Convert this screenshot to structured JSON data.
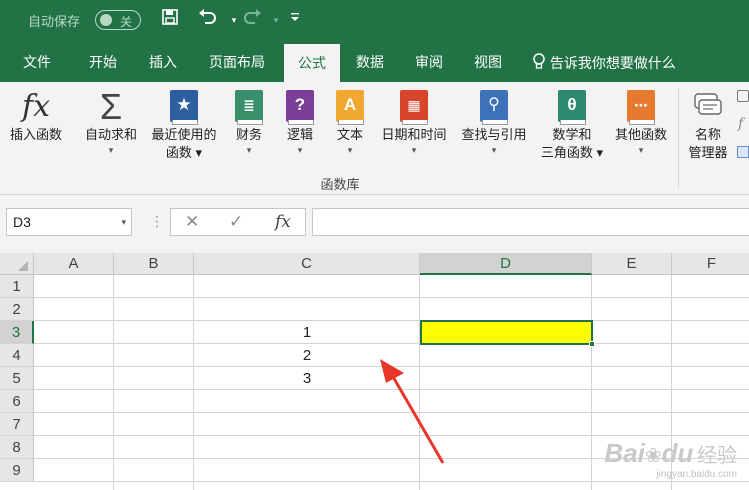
{
  "titlebar": {
    "autosave_label": "自动保存",
    "autosave_state": "关",
    "save_icon": "save-icon",
    "undo_icon": "undo-icon",
    "redo_icon": "redo-icon",
    "customize_icon": "customize-toolbar-icon"
  },
  "menu": {
    "tabs": [
      "文件",
      "开始",
      "插入",
      "页面布局",
      "公式",
      "数据",
      "审阅",
      "视图"
    ],
    "active": "公式",
    "tell_me": "告诉我你想要做什么"
  },
  "ribbon": {
    "buttons": [
      {
        "label1": "插入函数",
        "label2": ""
      },
      {
        "label1": "自动求和",
        "label2": "▾"
      },
      {
        "label1": "最近使用的",
        "label2": "函数 ▾"
      },
      {
        "label1": "财务",
        "label2": "▾"
      },
      {
        "label1": "逻辑",
        "label2": "▾"
      },
      {
        "label1": "文本",
        "label2": "▾"
      },
      {
        "label1": "日期和时间",
        "label2": "▾"
      },
      {
        "label1": "查找与引用",
        "label2": "▾"
      },
      {
        "label1": "数学和",
        "label2": "三角函数 ▾"
      },
      {
        "label1": "其他函数",
        "label2": "▾"
      },
      {
        "label1": "名称",
        "label2": "管理器"
      }
    ],
    "group_label": "函数库",
    "colors": {
      "star": "#2e5f9e",
      "finance": "#3a8f6a",
      "logic": "#7a3f99",
      "text": "#f0a830",
      "date": "#d9452b",
      "lookup": "#3d72b8",
      "math": "#2e8a6e",
      "other": "#e57a2e"
    }
  },
  "formula_bar": {
    "name_box": "D3",
    "cancel_icon": "✕",
    "enter_icon": "✓",
    "fx_icon": "fx",
    "value": ""
  },
  "sheet": {
    "columns": [
      "A",
      "B",
      "C",
      "D",
      "E",
      "F"
    ],
    "rows": [
      "1",
      "2",
      "3",
      "4",
      "5",
      "6",
      "7",
      "8",
      "9"
    ],
    "selected_cell": "D3",
    "selected_fill": "#ffff00",
    "values": {
      "C3": "1",
      "C4": "2",
      "C5": "3"
    }
  },
  "annotation": {
    "arrow_color": "#e8362a"
  },
  "watermark": {
    "brand": "Bai",
    "brand2": "du",
    "brand3": "经验",
    "url": "jingyan.baidu.com"
  }
}
